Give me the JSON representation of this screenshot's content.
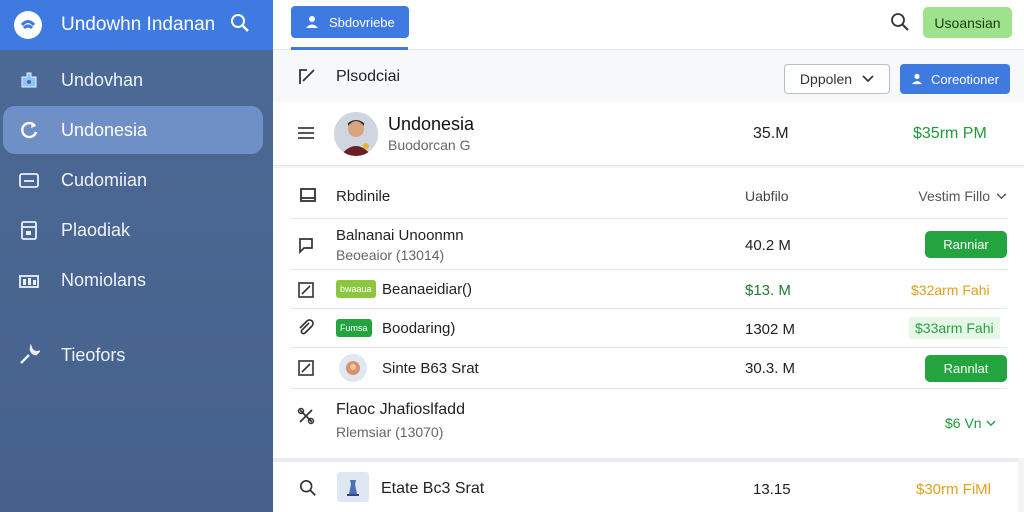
{
  "sidebar": {
    "app_title": "Undowhn Indanan",
    "items": [
      {
        "label": "Undovhan",
        "icon": "puzzle-icon",
        "active": false
      },
      {
        "label": "Undonesia",
        "icon": "refresh-icon",
        "active": true
      },
      {
        "label": "Cudomiian",
        "icon": "card-icon",
        "active": false
      },
      {
        "label": "Plaodiak",
        "icon": "document-icon",
        "active": false
      },
      {
        "label": "Nomiolans",
        "icon": "chart-icon",
        "active": false
      },
      {
        "label": "Tieofors",
        "icon": "wrench-icon",
        "active": false
      }
    ]
  },
  "topbar": {
    "primary_tab": "Sbdovriebe",
    "user_button": "Usoansian"
  },
  "toolbar": {
    "title": "Plsodciai",
    "select_value": "Dppolen",
    "primary_button": "Coreotioner"
  },
  "card": {
    "name": "Undonesia",
    "subtitle": "Buodorcan G",
    "amount": "35.M",
    "status": "$35rm PM"
  },
  "table": {
    "header": {
      "name": "Rbdinile",
      "amount": "Uabfilo",
      "filter": "Vestim Fillo"
    },
    "rows": [
      {
        "name": "Balnanai Unoonmn",
        "sub": "Beoeaior (13014)",
        "amount": "40.2 M",
        "status": "Ranniar",
        "status_kind": "button"
      },
      {
        "name": "Beanaeidiar()",
        "tag": "bwaaua",
        "amount": "$13. M",
        "status": "$32arm Fahi",
        "status_kind": "orange"
      },
      {
        "name": "Boodaring)",
        "tag": "Fumsa",
        "amount": "1302 M",
        "status": "$33arm Fahi",
        "status_kind": "green-light"
      },
      {
        "name": "Sinte B63 Srat",
        "amount": "30.3. M",
        "status": "Rannlat",
        "status_kind": "button"
      },
      {
        "name": "Flaoc Jhafioslfadd",
        "sub": "Rlemsiar (13070)",
        "amount": "",
        "status": "$6 Vn",
        "status_kind": "green-text"
      }
    ]
  },
  "bottom_row": {
    "name": "Etate Bc3 Srat",
    "amount": "13.15",
    "status": "$30rm FiMl"
  },
  "colors": {
    "accent": "#3f7ae0",
    "sidebar": "#4d6a96",
    "success": "#23a43f",
    "warning": "#e0a018"
  }
}
